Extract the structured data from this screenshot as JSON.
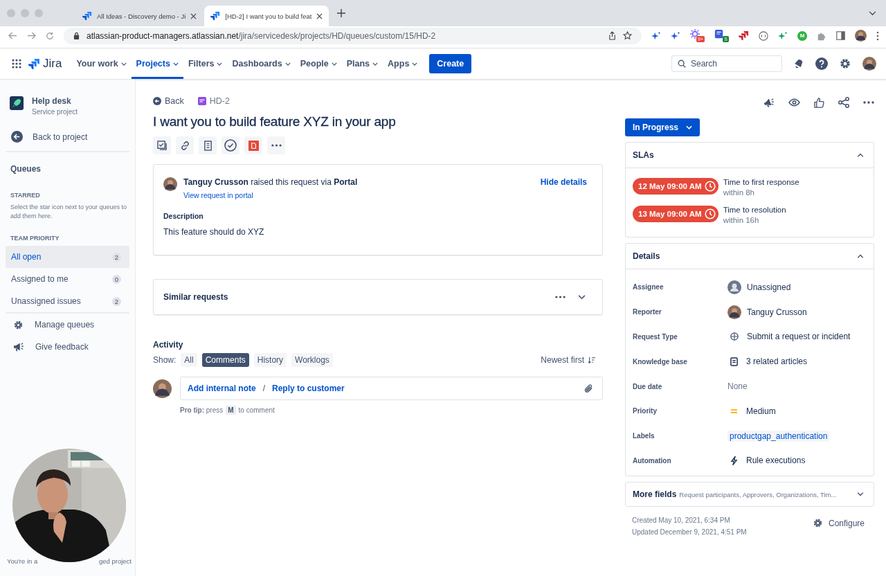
{
  "browser": {
    "tabs": [
      {
        "title": "All Ideas - Discovery demo - Ji",
        "selected": false
      },
      {
        "title": "[HD-2] I want you to build feat",
        "selected": true
      }
    ],
    "address": {
      "domain": "atlassian-product-managers.atlassian.net",
      "path": "/jira/servicedesk/projects/HD/queues/custom/15/HD-2"
    },
    "extensions": [
      {
        "kind": "sparkle-blue"
      },
      {
        "kind": "sparkle-blue"
      },
      {
        "kind": "sun",
        "badge": "9+"
      },
      {
        "kind": "doc",
        "badge": "S"
      },
      {
        "kind": "jira-red"
      },
      {
        "kind": "ring"
      },
      {
        "kind": "sparkle-green"
      },
      {
        "kind": "circle-letter",
        "badge": "M"
      },
      {
        "kind": "puzzle"
      },
      {
        "kind": "sidebar"
      },
      {
        "kind": "avatar"
      }
    ]
  },
  "nav": {
    "product": "Jira",
    "items": [
      {
        "label": "Your work",
        "selected": false
      },
      {
        "label": "Projects",
        "selected": true
      },
      {
        "label": "Filters",
        "selected": false
      },
      {
        "label": "Dashboards",
        "selected": false
      },
      {
        "label": "People",
        "selected": false
      },
      {
        "label": "Plans",
        "selected": false
      },
      {
        "label": "Apps",
        "selected": false
      }
    ],
    "create": "Create",
    "search_placeholder": "Search"
  },
  "sidebar": {
    "project": {
      "name": "Help desk",
      "type": "Service project"
    },
    "back": "Back to project",
    "queues_title": "Queues",
    "starred": {
      "heading": "STARRED",
      "hint": "Select the star icon next to your queues to add them here."
    },
    "team_priority": {
      "heading": "TEAM PRIORITY",
      "items": [
        {
          "label": "All open",
          "count": "2",
          "selected": true
        },
        {
          "label": "Assigned to me",
          "count": "0",
          "selected": false
        },
        {
          "label": "Unassigned issues",
          "count": "2",
          "selected": false
        }
      ]
    },
    "actions": [
      {
        "kind": "gear",
        "label": "Manage queues"
      },
      {
        "kind": "megaphone",
        "label": "Give feedback"
      }
    ],
    "footer": [
      "You're in a",
      "ged project"
    ],
    "video": {
      "kind": "picture"
    }
  },
  "issue": {
    "back": "Back",
    "key": "HD-2",
    "title": "I want you to build feature XYZ in your app",
    "request": {
      "reporter": "Tanguy Crusson",
      "raised": "raised this request via",
      "channel": "Portal",
      "hide": "Hide details",
      "view_link": "View request in portal",
      "description_label": "Description",
      "description": "This feature should do XYZ"
    },
    "similar": {
      "title": "Similar requests",
      "expanded": false
    },
    "activity": {
      "title": "Activity",
      "show_label": "Show:",
      "filters": [
        {
          "label": "All",
          "selected": false
        },
        {
          "label": "Comments",
          "selected": true
        },
        {
          "label": "History",
          "selected": false
        },
        {
          "label": "Worklogs",
          "selected": false
        }
      ],
      "sort": "Newest first",
      "internal_note": "Add internal note",
      "separator": "/",
      "reply": "Reply to customer",
      "tip": {
        "label": "Pro tip:",
        "press": "press",
        "key": "M",
        "after": "to comment"
      }
    }
  },
  "side": {
    "status": "In Progress",
    "slas": {
      "title": "SLAs",
      "expanded": true,
      "items": [
        {
          "due": "12 May 09:00 AM",
          "name": "Time to first response",
          "goal": "within 8h"
        },
        {
          "due": "13 May 09:00 AM",
          "name": "Time to resolution",
          "goal": "within 16h"
        }
      ]
    },
    "details": {
      "title": "Details",
      "expanded": true,
      "fields": [
        {
          "label": "Assignee",
          "value": "Unassigned",
          "kind": "empty-avatar"
        },
        {
          "label": "Reporter",
          "value": "Tanguy Crusson",
          "kind": "avatar"
        },
        {
          "label": "Request Type",
          "value": "Submit a request or incident",
          "kind": "globe"
        },
        {
          "label": "Knowledge base",
          "value": "3 related articles",
          "kind": "article"
        },
        {
          "label": "Due date",
          "value": "None",
          "kind": "none"
        },
        {
          "label": "Priority",
          "value": "Medium",
          "kind": "priority"
        },
        {
          "label": "Labels",
          "value": "productgap_authentication",
          "kind": "label"
        },
        {
          "label": "Automation",
          "value": "Rule executions",
          "kind": "bolt"
        }
      ]
    },
    "more_fields": {
      "title": "More fields",
      "summary": "Request participants, Approvers, Organizations, Tim...",
      "expanded": false
    },
    "created": "Created May 10, 2021, 6:34 PM",
    "updated": "Updated December 9, 2021, 4:51 PM",
    "configure": "Configure"
  }
}
